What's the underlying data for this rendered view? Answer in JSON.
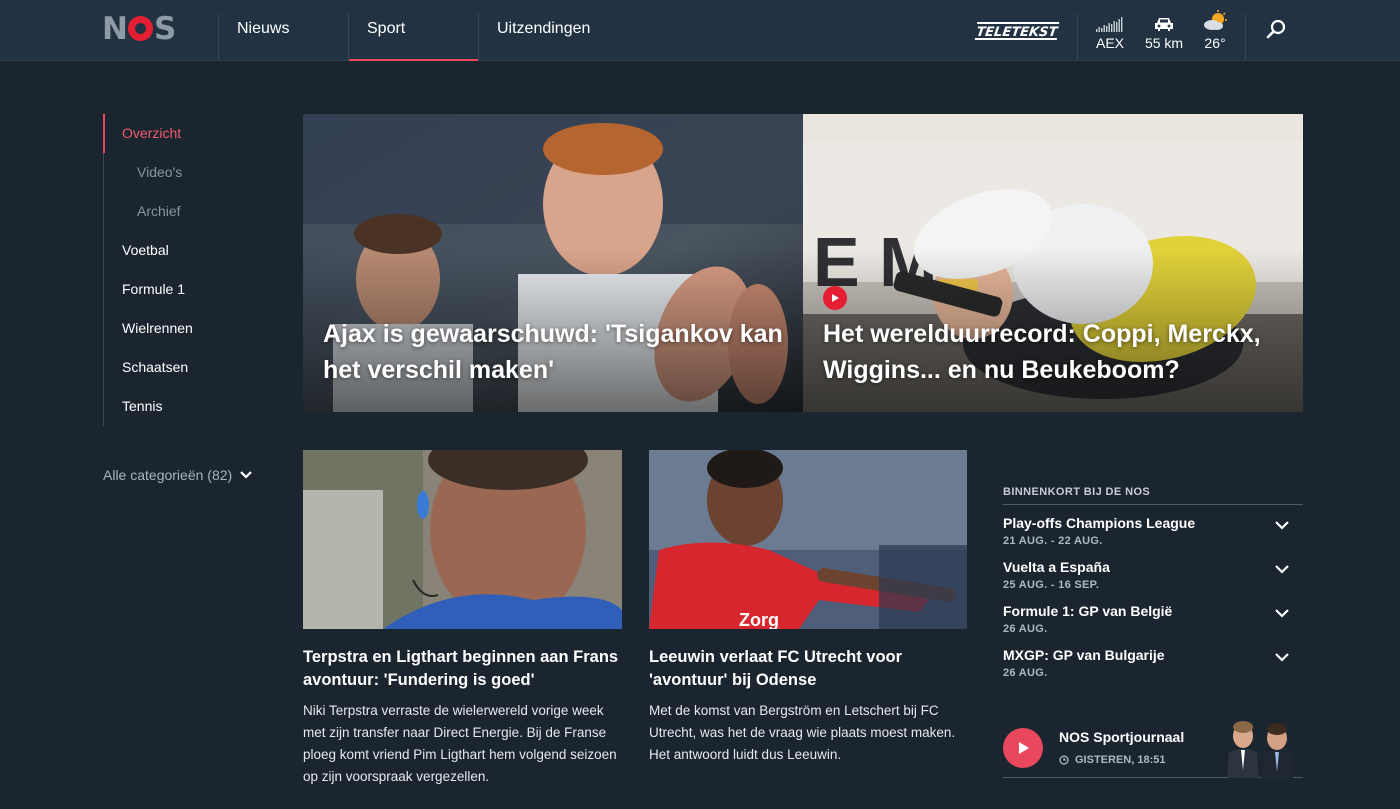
{
  "header": {
    "logo": "NOS",
    "nav": [
      {
        "label": "Nieuws",
        "active": false
      },
      {
        "label": "Sport",
        "active": true
      },
      {
        "label": "Uitzendingen",
        "active": false
      }
    ],
    "teletekst": "TELETEKST",
    "status": [
      {
        "icon": "chart-icon",
        "label": "AEX"
      },
      {
        "icon": "car-icon",
        "label": "55 km"
      },
      {
        "icon": "weather-icon",
        "label": "26°"
      }
    ]
  },
  "sidenav": {
    "items": [
      {
        "label": "Overzicht",
        "active": true
      },
      {
        "label": "Video's",
        "sub": true
      },
      {
        "label": "Archief",
        "sub": true
      },
      {
        "label": "Voetbal"
      },
      {
        "label": "Formule 1"
      },
      {
        "label": "Wielrennen"
      },
      {
        "label": "Schaatsen"
      },
      {
        "label": "Tennis"
      }
    ],
    "all_categories": "Alle categorieën (82)"
  },
  "hero": [
    {
      "title": "Ajax is gewaarschuwd: 'Tsigankov kan het verschil maken'",
      "video": false
    },
    {
      "title": "Het werelduurrecord: Coppi, Merckx, Wiggins... en nu Beukeboom?",
      "video": true
    }
  ],
  "cards": [
    {
      "title": "Terpstra en Ligthart beginnen aan Frans avontuur: 'Fundering is goed'",
      "summary": "Niki Terpstra verraste de wielerwereld vorige week met zijn transfer naar Direct Energie. Bij de Franse ploeg komt vriend Pim Ligthart hem volgend seizoen op zijn voorspraak vergezellen."
    },
    {
      "title": "Leeuwin verlaat FC Utrecht voor 'avontuur' bij Odense",
      "summary": "Met de komst van Bergström en Letschert bij FC Utrecht, was het de vraag wie plaats moest maken. Het antwoord luidt dus Leeuwin."
    }
  ],
  "upcoming": {
    "header": "BINNENKORT BIJ DE NOS",
    "items": [
      {
        "title": "Play-offs Champions League",
        "date": "21 AUG. - 22 AUG."
      },
      {
        "title": "Vuelta a España",
        "date": "25 AUG. - 16 SEP."
      },
      {
        "title": "Formule 1: GP van België",
        "date": "26 AUG."
      },
      {
        "title": "MXGP: GP van Bulgarije",
        "date": "26 AUG."
      }
    ]
  },
  "sportjournaal": {
    "title": "NOS Sportjournaal",
    "time": "GISTEREN, 18:51"
  },
  "colors": {
    "background": "#1b2530",
    "header": "#223243",
    "accent": "#e8475d",
    "brand_red": "#e61e34"
  }
}
